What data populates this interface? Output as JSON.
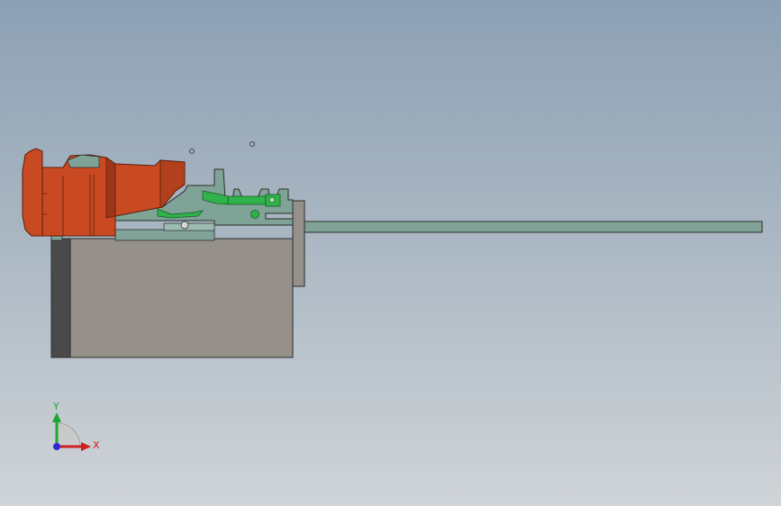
{
  "triad": {
    "x_label": "X",
    "y_label": "Y",
    "x_color": "#d02020",
    "y_color": "#1fa62f",
    "z_color": "#2a2ad8"
  },
  "colors": {
    "background_top": "#8da0b4",
    "background_bottom": "#cfd4d8",
    "housing_orange": "#c94a22",
    "housing_orange_dark": "#9e3516",
    "base_block": "#959089",
    "base_block_dark": "#4a4a4a",
    "frame_teal": "#7fa396",
    "rod_teal": "#7fa396",
    "spring_green": "#2fb34a"
  }
}
